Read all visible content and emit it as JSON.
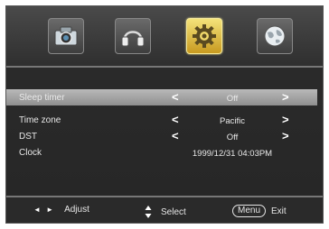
{
  "tabs": [
    {
      "icon": "camera-icon",
      "active": false
    },
    {
      "icon": "headphones-icon",
      "active": false
    },
    {
      "icon": "gear-icon",
      "active": true
    },
    {
      "icon": "globe-icon",
      "active": false
    }
  ],
  "settings": [
    {
      "label": "Sleep timer",
      "value": "Off",
      "selected": true,
      "has_arrows": true
    },
    {
      "label": "Time zone",
      "value": "Pacific",
      "selected": false,
      "has_arrows": true
    },
    {
      "label": "DST",
      "value": "Off",
      "selected": false,
      "has_arrows": true
    },
    {
      "label": "Clock",
      "value": "1999/12/31 04:03PM",
      "selected": false,
      "has_arrows": false
    }
  ],
  "arrows": {
    "left": "<",
    "right": ">"
  },
  "footer": {
    "adjust_keys": "◄ ►",
    "adjust_label": "Adjust",
    "select_label": "Select",
    "menu_key": "Menu",
    "exit_label": "Exit"
  },
  "colors": {
    "background": "#262626",
    "selected_row": "#a8a8a8",
    "active_tab": "#e6c64a"
  }
}
